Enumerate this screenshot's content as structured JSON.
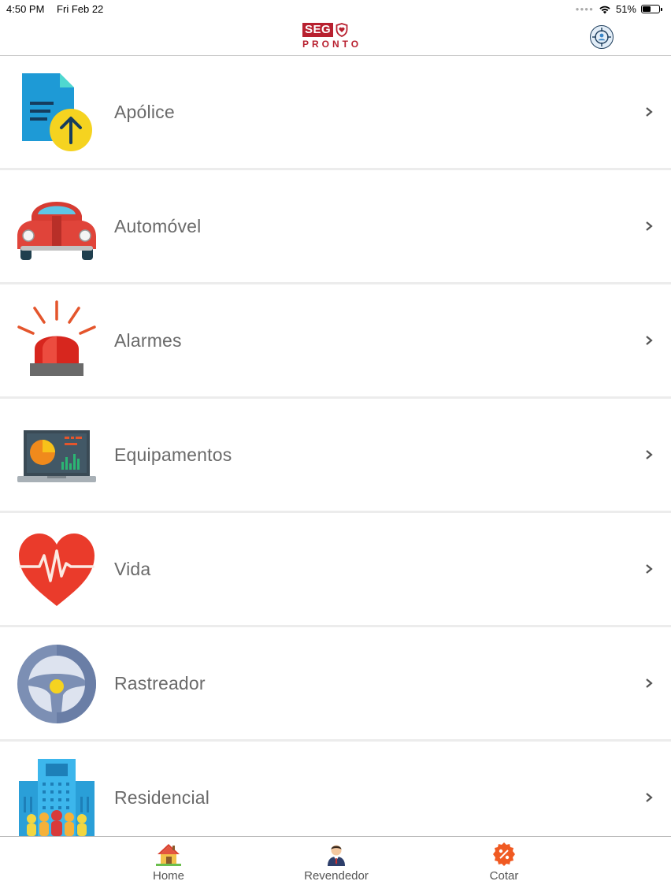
{
  "status_bar": {
    "time": "4:50 PM",
    "date": "Fri Feb 22",
    "battery": "51%",
    "battery_level": 0.51
  },
  "header": {
    "logo_top": "SEG",
    "logo_bottom": "PRONTO",
    "profile_icon": "user-target-icon"
  },
  "menu": {
    "items": [
      {
        "label": "Apólice",
        "icon": "document-upload-icon"
      },
      {
        "label": "Automóvel",
        "icon": "car-icon"
      },
      {
        "label": "Alarmes",
        "icon": "siren-icon"
      },
      {
        "label": "Equipamentos",
        "icon": "laptop-icon"
      },
      {
        "label": "Vida",
        "icon": "heart-pulse-icon"
      },
      {
        "label": "Rastreador",
        "icon": "steering-wheel-icon"
      },
      {
        "label": "Residencial",
        "icon": "building-icon"
      }
    ]
  },
  "tabs": [
    {
      "label": "Home",
      "icon": "house-icon"
    },
    {
      "label": "Revendedor",
      "icon": "businessman-icon"
    },
    {
      "label": "Cotar",
      "icon": "percent-badge-icon"
    }
  ],
  "colors": {
    "brand_red": "#b8202f",
    "label_gray": "#6a6a6a",
    "divider": "#ececec"
  }
}
